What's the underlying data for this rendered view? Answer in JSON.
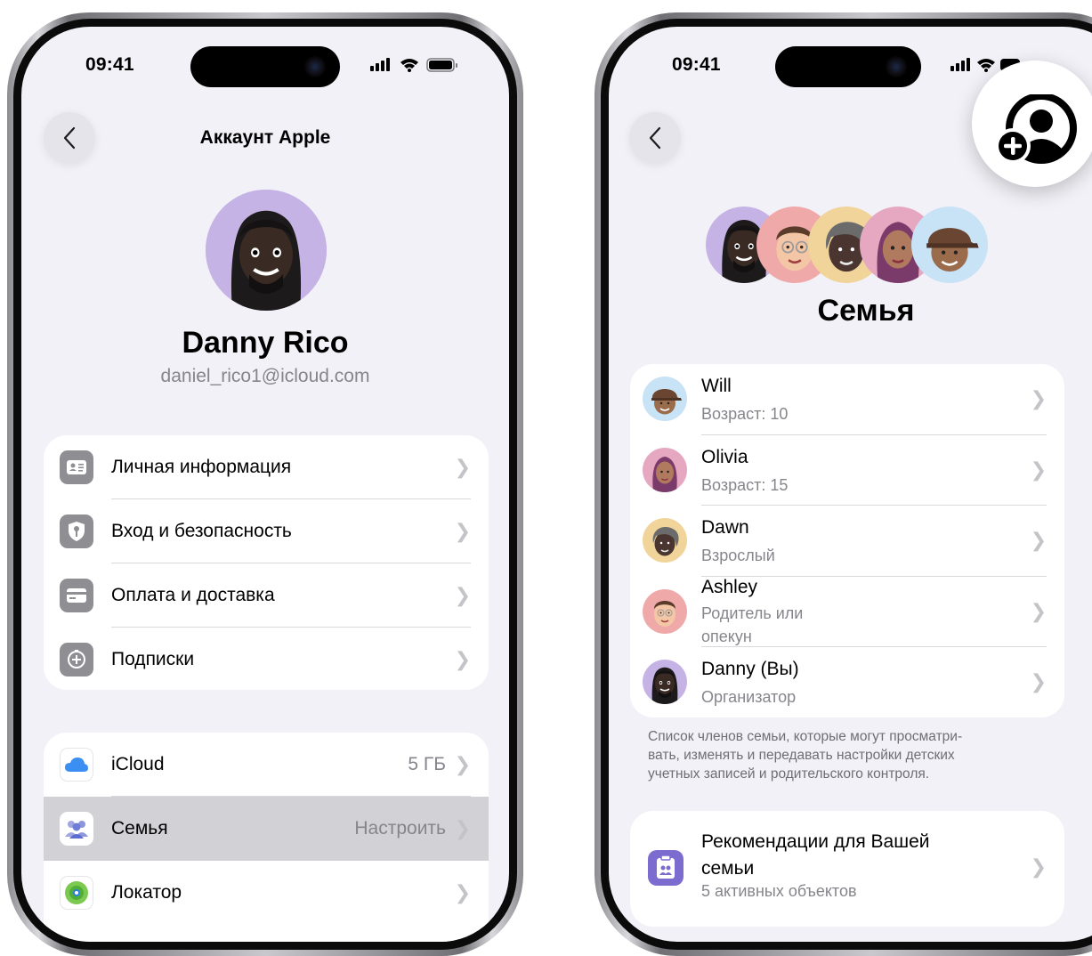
{
  "left": {
    "status_time": "09:41",
    "nav_title": "Аккаунт Apple",
    "profile": {
      "name": "Danny Rico",
      "email": "daniel_rico1@icloud.com"
    },
    "group1": [
      {
        "label": "Личная информация",
        "icon": "person-card-icon"
      },
      {
        "label": "Вход и безопасность",
        "icon": "shield-key-icon"
      },
      {
        "label": "Оплата и доставка",
        "icon": "credit-card-icon"
      },
      {
        "label": "Подписки",
        "icon": "subscriptions-plus-icon"
      }
    ],
    "group2": [
      {
        "label": "iCloud",
        "detail": "5 ГБ",
        "icon": "icloud-icon"
      },
      {
        "label": "Семья",
        "detail": "Настроить",
        "icon": "family-icon",
        "highlighted": true
      },
      {
        "label": "Локатор",
        "detail": "",
        "icon": "find-my-icon"
      }
    ]
  },
  "right": {
    "status_time": "09:41",
    "title": "Семья",
    "members": [
      {
        "name": "Will",
        "role": "Возраст: 10"
      },
      {
        "name": "Olivia",
        "role": "Возраст: 15"
      },
      {
        "name": "Dawn",
        "role": "Взрослый"
      },
      {
        "name": "Ashley",
        "role_line1": "Родитель или",
        "role_line2": "опекун"
      },
      {
        "name": "Danny (Вы)",
        "role": "Организатор"
      }
    ],
    "footnote": {
      "line1": "Список членов семьи, которые могут просматри-",
      "line2": "вать, изменять и передавать настройки детских",
      "line3": "учетных записей и родительского контроля."
    },
    "recommendations": {
      "title_line1": "Рекомендации для Вашей",
      "title_line2": "семьи",
      "subtitle": "5 активных объектов"
    }
  },
  "colors": {
    "screen_bg": "#f2f1f7",
    "secondary_text": "#86858b",
    "icon_gray": "#8e8e93",
    "highlight_row": "#d1d1d6"
  }
}
